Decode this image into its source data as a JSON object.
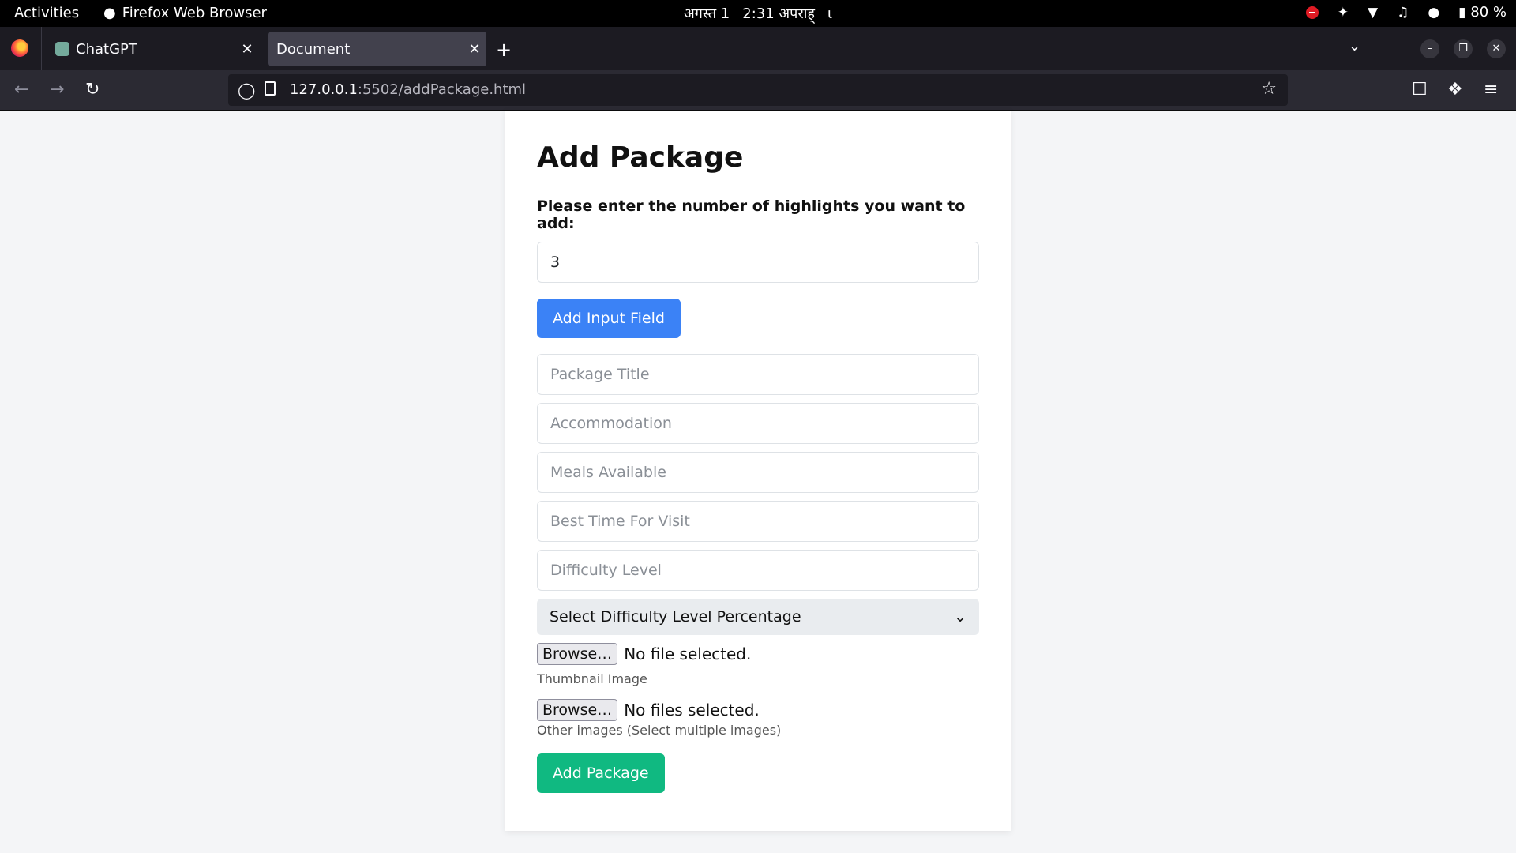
{
  "system_bar": {
    "activities": "Activities",
    "app_name": "Firefox Web Browser",
    "date": "अगस्त 1",
    "time": "2:31 अपराह्",
    "battery": "80 %"
  },
  "browser": {
    "tabs": [
      {
        "label": "ChatGPT",
        "active": false
      },
      {
        "label": "Document",
        "active": true
      }
    ],
    "url_host": "127.0.0.1",
    "url_path": ":5502/addPackage.html"
  },
  "form": {
    "title": "Add Package",
    "highlights_label": "Please enter the number of highlights you want to add:",
    "highlights_value": "3",
    "add_input_button": "Add Input Field",
    "placeholders": {
      "title": "Package Title",
      "accommodation": "Accommodation",
      "meals": "Meals Available",
      "best_time": "Best Time For Visit",
      "difficulty": "Difficulty Level"
    },
    "select_label": "Select Difficulty Level Percentage",
    "browse_label": "Browse…",
    "thumbnail_status": "No file selected.",
    "thumbnail_hint": "Thumbnail Image",
    "others_status": "No files selected.",
    "others_hint": "Other images (Select multiple images)",
    "submit_button": "Add Package"
  },
  "colors": {
    "primary": "#3b82f6",
    "success": "#10b981"
  }
}
